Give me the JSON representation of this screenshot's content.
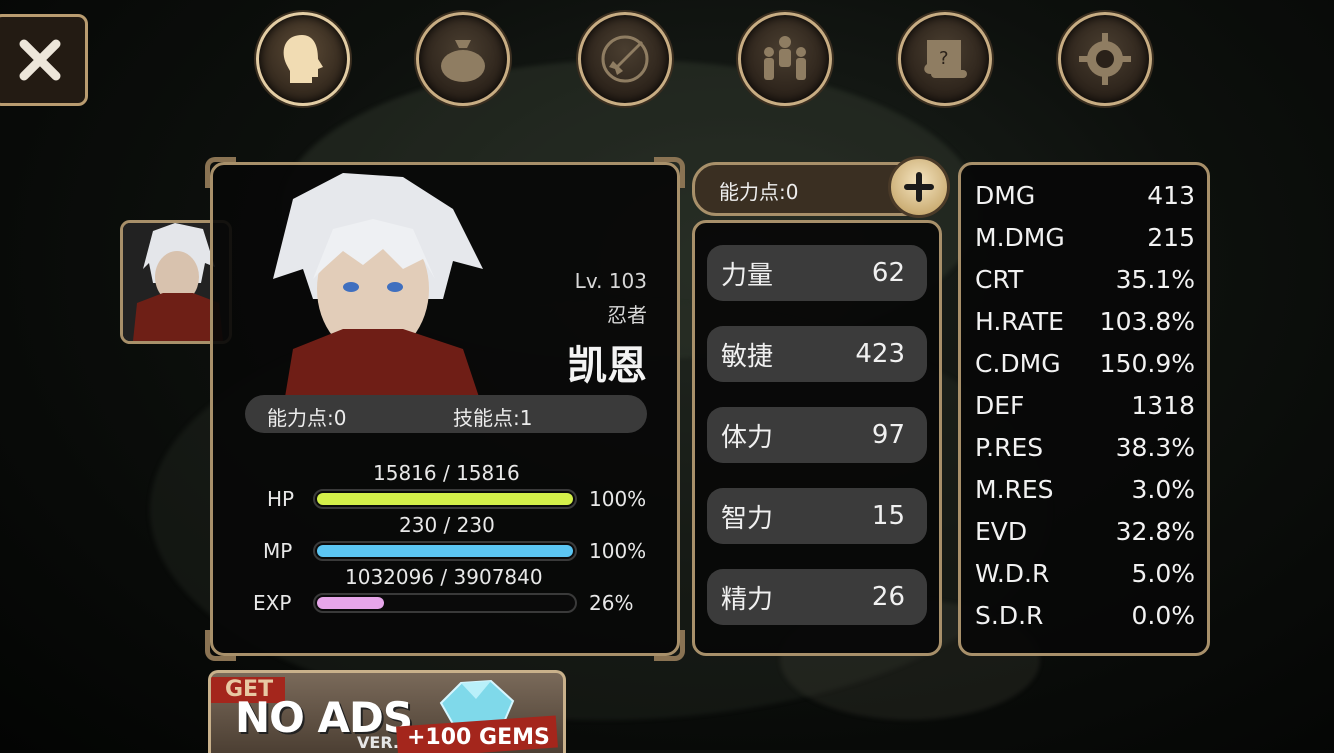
{
  "nav": {
    "close_label": "close",
    "tabs": [
      {
        "id": "character",
        "icon": "head-icon"
      },
      {
        "id": "bag",
        "icon": "bag-icon"
      },
      {
        "id": "equipment",
        "icon": "sword-shield-icon"
      },
      {
        "id": "party",
        "icon": "people-icon"
      },
      {
        "id": "quest",
        "icon": "scroll-icon"
      },
      {
        "id": "settings",
        "icon": "gear-icon"
      }
    ]
  },
  "character": {
    "level": "Lv. 103",
    "class": "忍者",
    "name": "凯恩",
    "ability_points_label": "能力点:0",
    "skill_points_label": "技能点:1",
    "hp": {
      "label": "HP",
      "current": "15816",
      "max": "15816",
      "text": "15816 / 15816",
      "percent": "100%",
      "fill": 1.0
    },
    "mp": {
      "label": "MP",
      "current": "230",
      "max": "230",
      "text": "230 / 230",
      "percent": "100%",
      "fill": 1.0
    },
    "exp": {
      "label": "EXP",
      "current": "1032096",
      "max": "3907840",
      "text": "1032096 / 3907840",
      "percent": "26%",
      "fill": 0.26
    }
  },
  "stats_panel": {
    "points_label": "能力点:0",
    "rows": [
      {
        "label": "力量",
        "value": "62"
      },
      {
        "label": "敏捷",
        "value": "423"
      },
      {
        "label": "体力",
        "value": "97"
      },
      {
        "label": "智力",
        "value": "15"
      },
      {
        "label": "精力",
        "value": "26"
      }
    ]
  },
  "derived_stats": [
    {
      "label": "DMG",
      "value": "413"
    },
    {
      "label": "M.DMG",
      "value": "215"
    },
    {
      "label": "CRT",
      "value": "35.1%"
    },
    {
      "label": "H.RATE",
      "value": "103.8%"
    },
    {
      "label": "C.DMG",
      "value": "150.9%"
    },
    {
      "label": "DEF",
      "value": "1318"
    },
    {
      "label": "P.RES",
      "value": "38.3%"
    },
    {
      "label": "M.RES",
      "value": "3.0%"
    },
    {
      "label": "EVD",
      "value": "32.8%"
    },
    {
      "label": "W.D.R",
      "value": "5.0%"
    },
    {
      "label": "S.D.R",
      "value": "0.0%"
    }
  ],
  "ad_banner": {
    "get": "GET",
    "no_ads": "NO ADS",
    "ver": "VER.",
    "gems": "+100 GEMS"
  },
  "colors": {
    "hp": "#d4f04a",
    "mp": "#5cc6f3",
    "exp": "#e7a6ea",
    "frame": "#a8906a"
  }
}
